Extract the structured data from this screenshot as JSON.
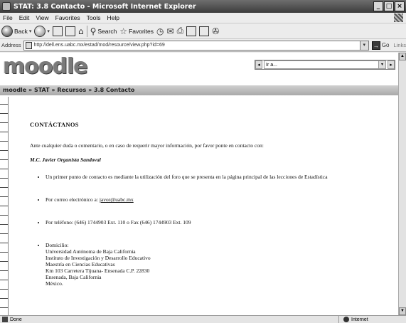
{
  "window": {
    "title": "STAT: 3.8 Contacto - Microsoft Internet Explorer"
  },
  "menu": [
    "File",
    "Edit",
    "View",
    "Favorites",
    "Tools",
    "Help"
  ],
  "toolbar": {
    "back_label": "Back",
    "search_label": "Search",
    "favorites_label": "Favorites"
  },
  "address": {
    "label": "Address",
    "url": "http://dell.ens.uabc.mx/estad/mod/resource/view.php?id=69",
    "go_label": "Go",
    "links_label": "Links"
  },
  "moodle": {
    "logo": "moodle",
    "jump_value": "Ir a..."
  },
  "breadcrumb": "moodle » STAT » Recursos » 3.8 Contacto",
  "page": {
    "heading": "CONTÁCTANOS",
    "intro": "Ante cualquier duda o comentario, o en caso de requerir mayor información, por favor ponte en contacto con:",
    "signature": "M.C. Javier Organista Sandoval",
    "items": {
      "forum": "Un primer punto de contacto es mediante la utilización del foro que se presenta en la página principal de las lecciones de Estadística",
      "email_prefix": "Por correo electrónico a: ",
      "email": "javor@uabc.mx",
      "phone": "Por teléfono: (646) 1744903 Ext. 110 o Fax (646) 1744903 Ext. 109",
      "address_label": "Domicilio:",
      "address_lines": [
        "Universidad Autónoma de Baja California",
        "Instituto de Investigación y Desarrollo Educativo",
        "Maestría en Ciencias Educativas",
        "Km 103 Carretera Tijuana- Ensenada C.P. 22830",
        "Ensenada, Baja California",
        "México."
      ]
    }
  },
  "status": {
    "left": "Done",
    "zone": "Internet"
  }
}
